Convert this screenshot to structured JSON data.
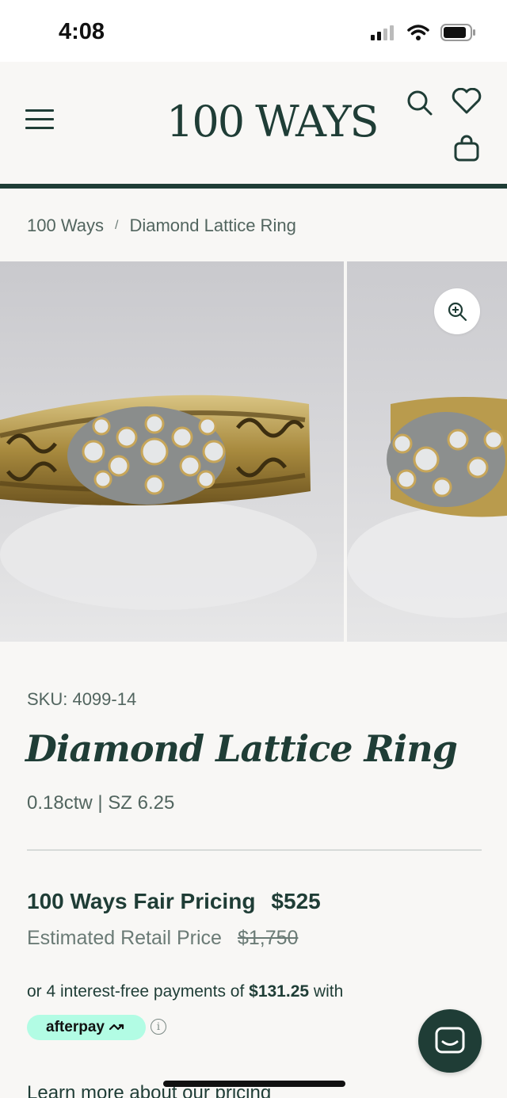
{
  "status_bar": {
    "time": "4:08"
  },
  "header": {
    "logo": "100 WAYS"
  },
  "breadcrumb": {
    "home": "100 Ways",
    "separator": "/",
    "current": "Diamond Lattice Ring"
  },
  "product": {
    "sku": "SKU: 4099-14",
    "title": "Diamond Lattice Ring",
    "spec": "0.18ctw | SZ 6.25",
    "fair_price_label": "100 Ways Fair Pricing",
    "fair_price": "$525",
    "retail_label": "Estimated Retail Price",
    "retail_price": "$1,750",
    "installment_prefix": "or 4 interest-free payments of ",
    "installment_amount": "$131.25",
    "installment_suffix": " with",
    "afterpay_label": "afterpay",
    "learn_more": "Learn more about our pricing"
  },
  "colors": {
    "brand": "#1f3d36",
    "afterpay": "#b2fce4",
    "background": "#f8f7f5"
  }
}
